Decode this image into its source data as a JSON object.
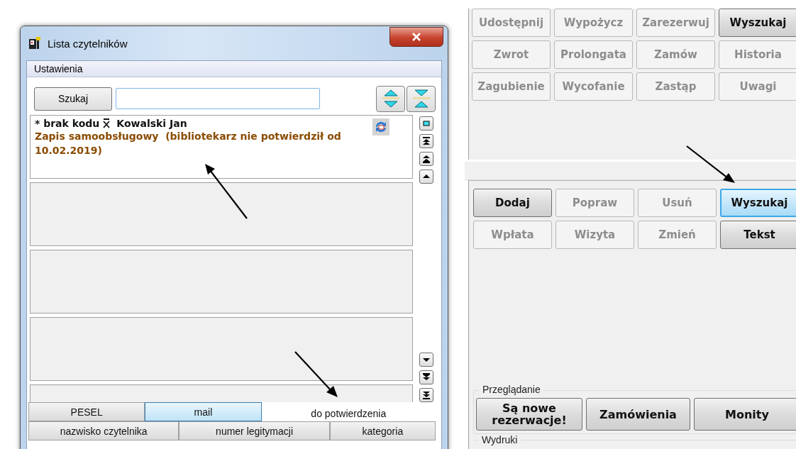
{
  "dialog": {
    "title": "Lista czytelników",
    "menu": [
      "Ustawienia"
    ],
    "search_button": "Szukaj",
    "records": [
      {
        "flag": "* brak kodu",
        "name": "Kowalski Jan",
        "note": "Zapis samoobsługowy  (bibliotekarz nie potwierdził od 10.02.2019)"
      }
    ],
    "tabs_back": [
      {
        "label": "PESEL",
        "selected": false,
        "highlighted": false
      },
      {
        "label": "mail",
        "selected": false,
        "highlighted": true
      },
      {
        "label": "do potwierdzenia",
        "selected": true,
        "highlighted": false
      }
    ],
    "tabs_front": [
      {
        "label": "nazwisko czytelnika",
        "selected": false,
        "highlighted": false
      },
      {
        "label": "numer legitymacji",
        "selected": false,
        "highlighted": false
      },
      {
        "label": "kategoria",
        "selected": false,
        "highlighted": false
      }
    ]
  },
  "item_buttons": [
    {
      "label": "Udostępnij",
      "disabled": true,
      "focused": false
    },
    {
      "label": "Wypożycz",
      "disabled": true,
      "focused": false
    },
    {
      "label": "Zarezerwuj",
      "disabled": true,
      "focused": false
    },
    {
      "label": "Wyszukaj",
      "disabled": false,
      "focused": false
    },
    {
      "label": "Zwrot",
      "disabled": true,
      "focused": false
    },
    {
      "label": "Prolongata",
      "disabled": true,
      "focused": false
    },
    {
      "label": "Zamów",
      "disabled": true,
      "focused": false
    },
    {
      "label": "Historia",
      "disabled": true,
      "focused": false
    },
    {
      "label": "Zagubienie",
      "disabled": true,
      "focused": false
    },
    {
      "label": "Wycofanie",
      "disabled": true,
      "focused": false
    },
    {
      "label": "Zastąp",
      "disabled": true,
      "focused": false
    },
    {
      "label": "Uwagi",
      "disabled": true,
      "focused": false
    }
  ],
  "reader_buttons": [
    {
      "label": "Dodaj",
      "disabled": false,
      "focused": false
    },
    {
      "label": "Popraw",
      "disabled": true,
      "focused": false
    },
    {
      "label": "Usuń",
      "disabled": true,
      "focused": false
    },
    {
      "label": "Wyszukaj",
      "disabled": false,
      "focused": true
    },
    {
      "label": "Wpłata",
      "disabled": true,
      "focused": false
    },
    {
      "label": "Wizyta",
      "disabled": true,
      "focused": false
    },
    {
      "label": "Zmień",
      "disabled": true,
      "focused": false
    },
    {
      "label": "Tekst",
      "disabled": false,
      "focused": false
    }
  ],
  "browse": {
    "title": "Przeglądanie",
    "buttons": [
      "Są nowe rezerwacje!",
      "Zamówienia",
      "Monity"
    ]
  },
  "prints": {
    "title": "Wydruki"
  }
}
